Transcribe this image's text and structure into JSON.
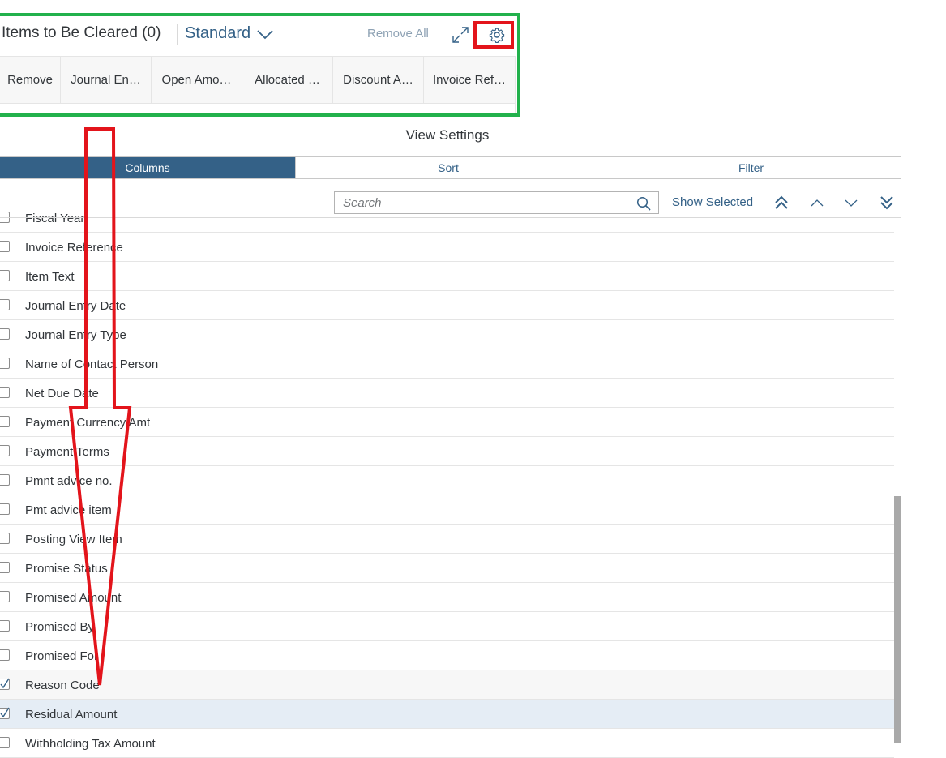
{
  "table_toolbar": {
    "title": "Items to Be Cleared (0)",
    "variant": "Standard",
    "remove_all": "Remove All",
    "expand_icon": "expand-icon",
    "settings_icon": "gear-icon"
  },
  "columns": [
    "Remove",
    "Journal En…",
    "Open Amo…",
    "Allocated …",
    "Discount A…",
    "Invoice Ref…"
  ],
  "dialog": {
    "title": "View Settings",
    "tabs": [
      "Columns",
      "Sort",
      "Filter"
    ],
    "active_tab": "Columns",
    "search_placeholder": "Search",
    "show_selected": "Show Selected"
  },
  "rows": [
    {
      "label": "Fiscal Year",
      "checked": false
    },
    {
      "label": "Invoice Reference",
      "checked": false
    },
    {
      "label": "Item Text",
      "checked": false
    },
    {
      "label": "Journal Entry Date",
      "checked": false
    },
    {
      "label": "Journal Entry Type",
      "checked": false
    },
    {
      "label": "Name of Contact Person",
      "checked": false
    },
    {
      "label": "Net Due Date",
      "checked": false
    },
    {
      "label": "Payment Currency Amt",
      "checked": false
    },
    {
      "label": "Payment Terms",
      "checked": false
    },
    {
      "label": "Pmnt advice no.",
      "checked": false
    },
    {
      "label": "Pmt advice item",
      "checked": false
    },
    {
      "label": "Posting View Item",
      "checked": false
    },
    {
      "label": "Promise Status",
      "checked": false
    },
    {
      "label": "Promised Amount",
      "checked": false
    },
    {
      "label": "Promised By",
      "checked": false
    },
    {
      "label": "Promised For",
      "checked": false
    },
    {
      "label": "Reason Code",
      "checked": true
    },
    {
      "label": "Residual Amount",
      "checked": true
    },
    {
      "label": "Withholding Tax Amount",
      "checked": false
    }
  ],
  "colors": {
    "highlight_green": "#22b14c",
    "highlight_red": "#e3141b",
    "accent": "#346187"
  }
}
